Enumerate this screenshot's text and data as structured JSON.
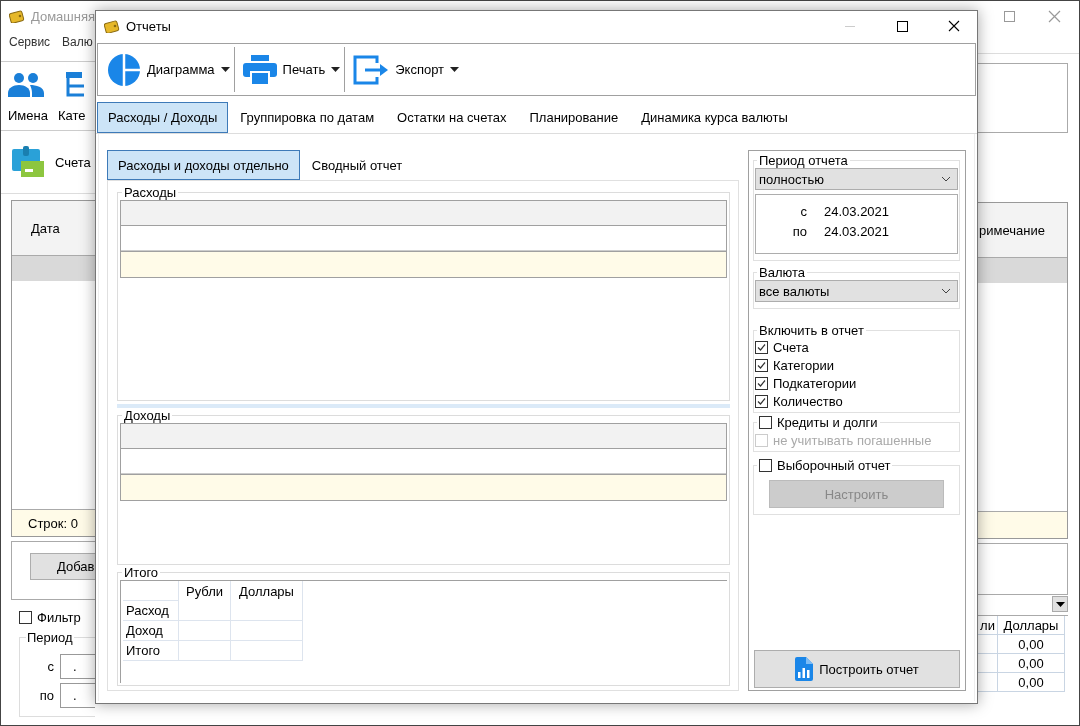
{
  "main_window": {
    "title": "Домашняя",
    "menu": [
      "Сервис",
      "Валю"
    ],
    "toolbar": [
      {
        "label": "Имена"
      },
      {
        "label": "Кате"
      }
    ],
    "accounts_label": "Счета",
    "table": {
      "columns": [
        "Дата",
        "римечание"
      ],
      "row_count": "Строк: 0"
    },
    "add_button": "Добав",
    "filter": {
      "label": "Фильтр",
      "checked": false
    },
    "period": {
      "title": "Период",
      "from_label": "с",
      "from_value": ".",
      "to_label": "по",
      "to_value": "."
    },
    "totals": {
      "columns": [
        "ли",
        "Доллары"
      ],
      "values": [
        "0,00",
        "0,00",
        "0,00"
      ]
    }
  },
  "dialog": {
    "title": "Отчеты",
    "toolbar": [
      {
        "label": "Диаграмма"
      },
      {
        "label": "Печать"
      },
      {
        "label": "Экспорт"
      }
    ],
    "tabs": [
      {
        "label": "Расходы / Доходы",
        "selected": true
      },
      {
        "label": "Группировка по датам",
        "selected": false
      },
      {
        "label": "Остатки на счетах",
        "selected": false
      },
      {
        "label": "Планирование",
        "selected": false
      },
      {
        "label": "Динамика курса валюты",
        "selected": false
      }
    ],
    "subtabs": [
      {
        "label": "Расходы и доходы отдельно",
        "selected": true
      },
      {
        "label": "Сводный отчет",
        "selected": false
      }
    ],
    "expenses": {
      "title": "Расходы"
    },
    "income": {
      "title": "Доходы"
    },
    "totals": {
      "title": "Итого",
      "columns": [
        "Рубли",
        "Доллары"
      ],
      "rows": [
        "Расход",
        "Доход",
        "Итого"
      ]
    },
    "period": {
      "title": "Период отчета",
      "value": "полностью",
      "from_label": "с",
      "from": "24.03.2021",
      "to_label": "по",
      "to": "24.03.2021"
    },
    "currency": {
      "title": "Валюта",
      "value": "все валюты"
    },
    "include": {
      "title": "Включить в отчет",
      "items": [
        {
          "label": "Счета",
          "checked": true
        },
        {
          "label": "Категории",
          "checked": true
        },
        {
          "label": "Подкатегории",
          "checked": true
        },
        {
          "label": "Количество",
          "checked": true
        }
      ]
    },
    "credits": {
      "label": "Кредиты и долги",
      "checked": false,
      "sub": {
        "label": "не учитывать погашенные",
        "checked": false,
        "disabled": true
      }
    },
    "custom": {
      "label": "Выборочный отчет",
      "checked": false,
      "button": {
        "label": "Настроить",
        "disabled": true
      }
    },
    "build_button": "Построить отчет"
  }
}
